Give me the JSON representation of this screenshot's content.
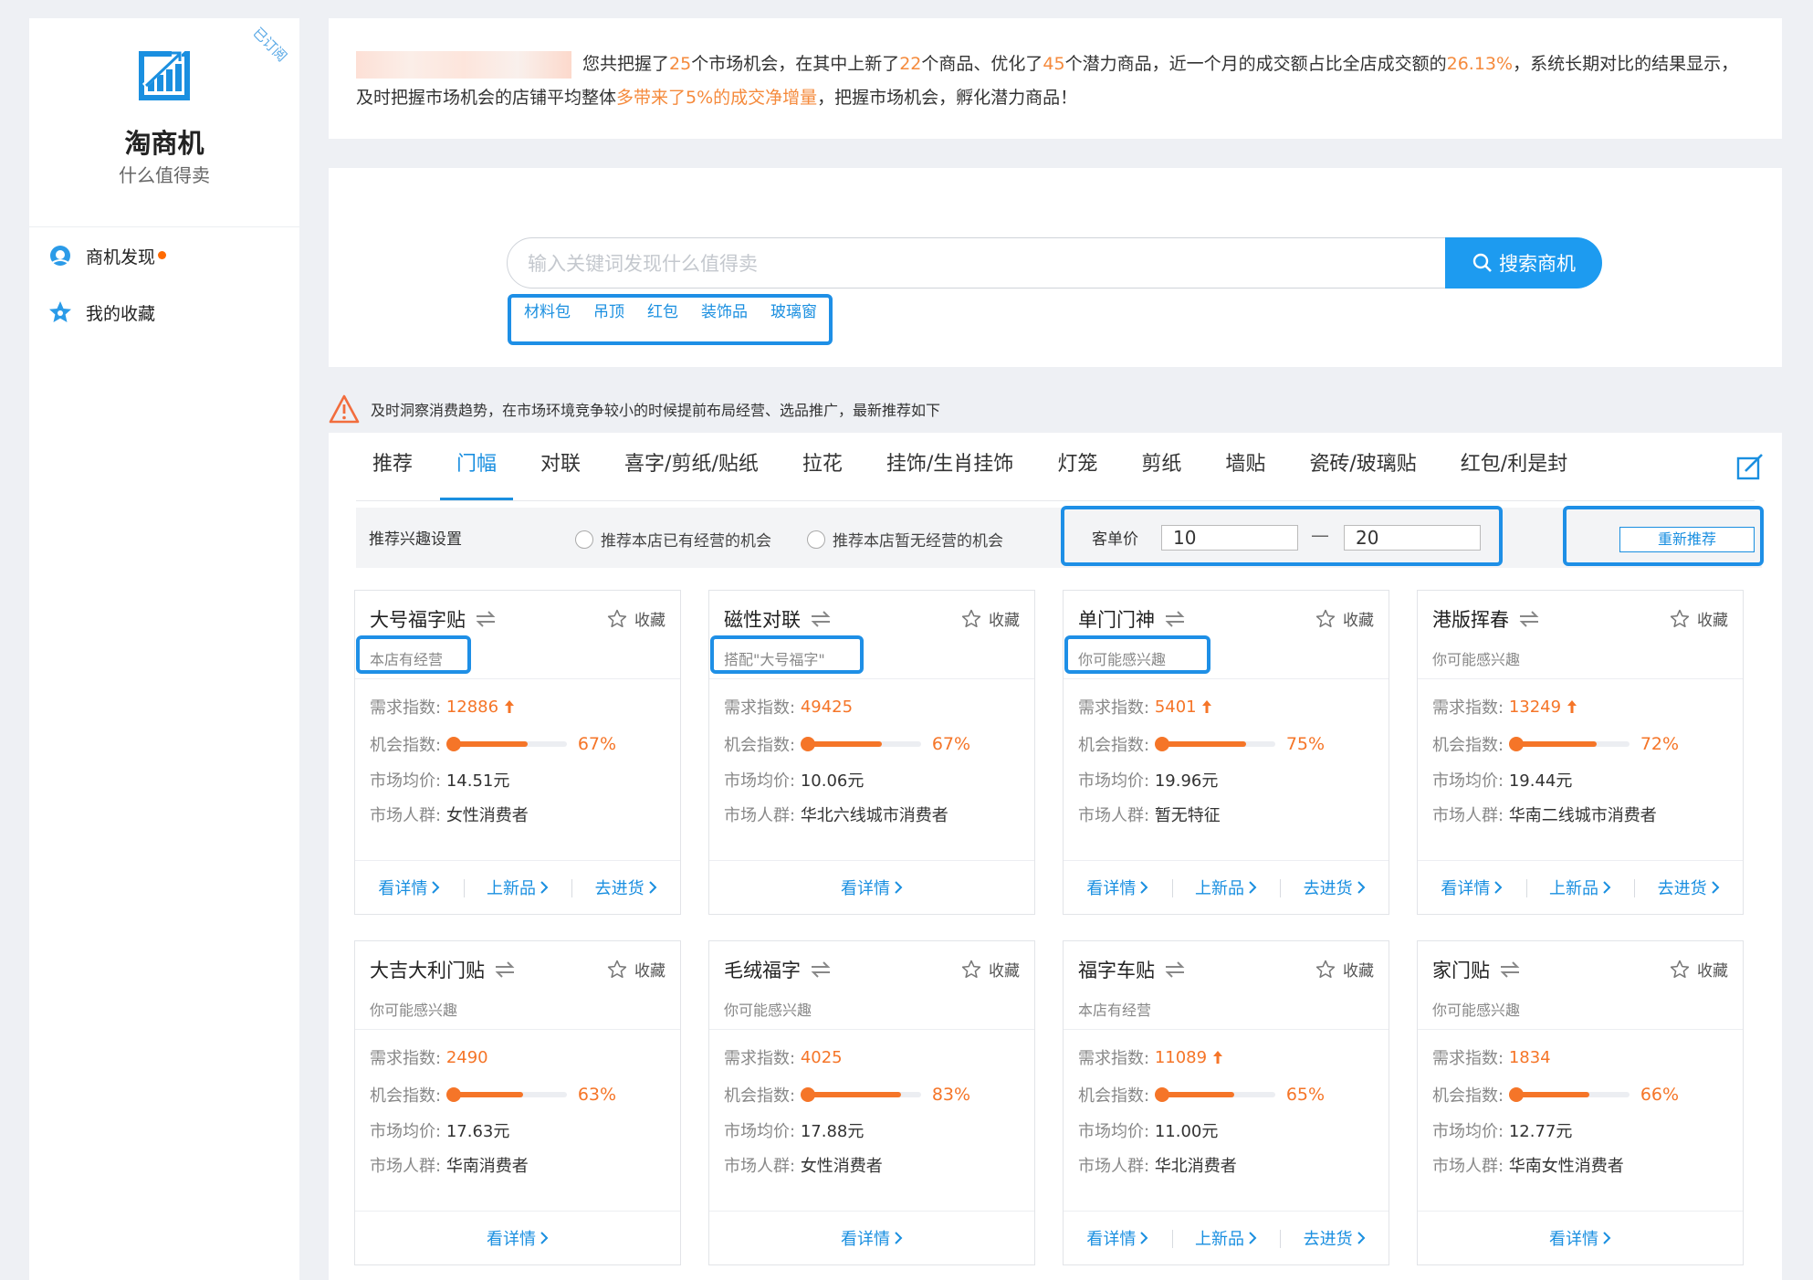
{
  "sidebar": {
    "brand": "淘商机",
    "slogan": "什么值得卖",
    "badge": "已订阅",
    "nav": [
      {
        "label": "商机发现",
        "icon": "discover-icon"
      },
      {
        "label": "我的收藏",
        "icon": "star-icon"
      }
    ]
  },
  "notice": {
    "p1": "您共把握了",
    "n1": "25",
    "p2": "个市场机会，在其中上新了",
    "n2": "22",
    "p3": "个商品、优化了",
    "n3": "45",
    "p4": "个潜力商品，近一个月的成交额占比全店成交额的",
    "n4": "26.13%",
    "p5": "，系统长期对比的结果显示，及时把握市场机会的店铺平均整体",
    "n5": "多带来了5%的成交净增量",
    "p6": "，把握市场机会，孵化潜力商品！"
  },
  "search": {
    "placeholder": "输入关键词发现什么值得卖",
    "button": "搜索商机",
    "hot_words": [
      "材料包",
      "吊顶",
      "红包",
      "装饰品",
      "玻璃窗"
    ]
  },
  "tip": "及时洞察消费趋势，在市场环境竞争较小的时候提前布局经营、选品推广，最新推荐如下",
  "tabs": [
    "推荐",
    "门幅",
    "对联",
    "喜字/剪纸/贴纸",
    "拉花",
    "挂饰/生肖挂饰",
    "灯笼",
    "剪纸",
    "墙贴",
    "瓷砖/玻璃贴",
    "红包/利是封"
  ],
  "active_tab": "门幅",
  "filter": {
    "label": "推荐兴趣设置",
    "radio1": "推荐本店已有经营的机会",
    "radio2": "推荐本店暂无经营的机会",
    "price_label": "客单价",
    "price_min": "10",
    "price_dash": "—",
    "price_max": "20",
    "reset": "重新推荐"
  },
  "card_labels": {
    "fav": "收藏",
    "demand": "需求指数:",
    "chance": "机会指数:",
    "price": "市场均价:",
    "crowd": "市场人群:",
    "detail": "看详情",
    "new": "上新品",
    "stock": "去进货"
  },
  "cards": [
    {
      "title": "大号福字贴",
      "tag": "本店有经营",
      "demand": "12886",
      "up": true,
      "chance": 67,
      "chance_text": "67%",
      "price": "14.51元",
      "crowd": "女性消费者",
      "actions": 3
    },
    {
      "title": "磁性对联",
      "tag": "搭配\"大号福字\"",
      "demand": "49425",
      "up": false,
      "chance": 67,
      "chance_text": "67%",
      "price": "10.06元",
      "crowd": "华北六线城市消费者",
      "actions": 1
    },
    {
      "title": "单门门神",
      "tag": "你可能感兴趣",
      "demand": "5401",
      "up": true,
      "chance": 75,
      "chance_text": "75%",
      "price": "19.96元",
      "crowd": "暂无特征",
      "actions": 3
    },
    {
      "title": "港版挥春",
      "tag": "你可能感兴趣",
      "demand": "13249",
      "up": true,
      "chance": 72,
      "chance_text": "72%",
      "price": "19.44元",
      "crowd": "华南二线城市消费者",
      "actions": 3
    },
    {
      "title": "大吉大利门贴",
      "tag": "你可能感兴趣",
      "demand": "2490",
      "up": false,
      "chance": 63,
      "chance_text": "63%",
      "price": "17.63元",
      "crowd": "华南消费者",
      "actions": 1
    },
    {
      "title": "毛绒福字",
      "tag": "你可能感兴趣",
      "demand": "4025",
      "up": false,
      "chance": 83,
      "chance_text": "83%",
      "price": "17.88元",
      "crowd": "女性消费者",
      "actions": 1
    },
    {
      "title": "福字车贴",
      "tag": "本店有经营",
      "demand": "11089",
      "up": true,
      "chance": 65,
      "chance_text": "65%",
      "price": "11.00元",
      "crowd": "华北消费者",
      "actions": 3
    },
    {
      "title": "家门贴",
      "tag": "你可能感兴趣",
      "demand": "1834",
      "up": false,
      "chance": 66,
      "chance_text": "66%",
      "price": "12.77元",
      "crowd": "华南女性消费者",
      "actions": 1
    }
  ],
  "colors": {
    "accent": "#1a8fe0",
    "orange": "#f57528",
    "highlight": "#1e8fe6"
  }
}
